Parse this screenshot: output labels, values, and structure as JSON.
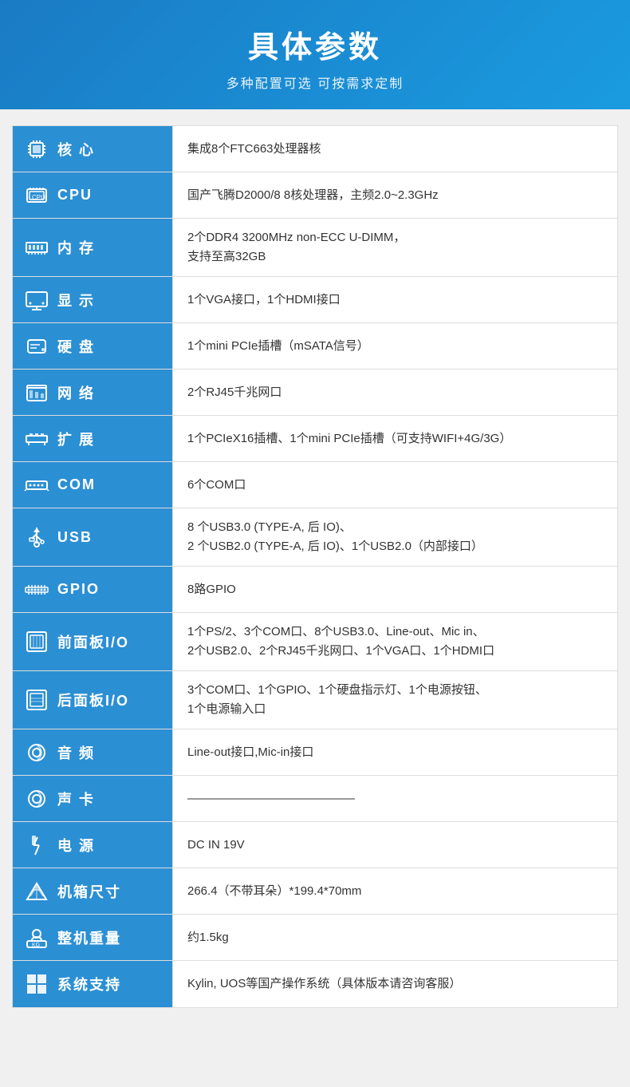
{
  "header": {
    "title": "具体参数",
    "subtitle": "多种配置可选 可按需求定制"
  },
  "specs": [
    {
      "id": "core",
      "label": "核  心",
      "icon": "core",
      "value": "集成8个FTC663处理器核"
    },
    {
      "id": "cpu",
      "label": "CPU",
      "icon": "cpu",
      "value": "国产飞腾D2000/8  8核处理器，主频2.0~2.3GHz"
    },
    {
      "id": "ram",
      "label": "内  存",
      "icon": "ram",
      "value": "2个DDR4 3200MHz non-ECC U-DIMM，\n支持至高32GB"
    },
    {
      "id": "display",
      "label": "显  示",
      "icon": "display",
      "value": "1个VGA接口，1个HDMI接口"
    },
    {
      "id": "hdd",
      "label": "硬  盘",
      "icon": "hdd",
      "value": "1个mini PCIe插槽（mSATA信号）"
    },
    {
      "id": "network",
      "label": "网  络",
      "icon": "network",
      "value": "2个RJ45千兆网口"
    },
    {
      "id": "expand",
      "label": "扩  展",
      "icon": "expand",
      "value": "1个PCIeX16插槽、1个mini PCIe插槽（可支持WIFI+4G/3G）"
    },
    {
      "id": "com",
      "label": "COM",
      "icon": "com",
      "value": "6个COM口"
    },
    {
      "id": "usb",
      "label": "USB",
      "icon": "usb",
      "value": "8 个USB3.0 (TYPE-A, 后 IO)、\n2 个USB2.0 (TYPE-A, 后 IO)、1个USB2.0（内部接口）"
    },
    {
      "id": "gpio",
      "label": "GPIO",
      "icon": "gpio",
      "value": "8路GPIO"
    },
    {
      "id": "front-io",
      "label": "前面板I/O",
      "icon": "front-io",
      "value": "1个PS/2、3个COM口、8个USB3.0、Line-out、Mic in、\n2个USB2.0、2个RJ45千兆网口、1个VGA口、1个HDMI口"
    },
    {
      "id": "rear-io",
      "label": "后面板I/O",
      "icon": "rear-io",
      "value": "3个COM口、1个GPIO、1个硬盘指示灯、1个电源按钮、\n1个电源输入口"
    },
    {
      "id": "audio",
      "label": "音  频",
      "icon": "audio",
      "value": "Line-out接口,Mic-in接口"
    },
    {
      "id": "soundcard",
      "label": "声  卡",
      "icon": "soundcard",
      "value": "——————————————"
    },
    {
      "id": "power",
      "label": "电  源",
      "icon": "power",
      "value": "DC IN 19V"
    },
    {
      "id": "chassis",
      "label": "机箱尺寸",
      "icon": "chassis",
      "value": "266.4（不带耳朵）*199.4*70mm"
    },
    {
      "id": "weight",
      "label": "整机重量",
      "icon": "weight",
      "value": "约1.5kg"
    },
    {
      "id": "os",
      "label": "系统支持",
      "icon": "os",
      "value": "Kylin, UOS等国产操作系统（具体版本请咨询客服）"
    }
  ]
}
